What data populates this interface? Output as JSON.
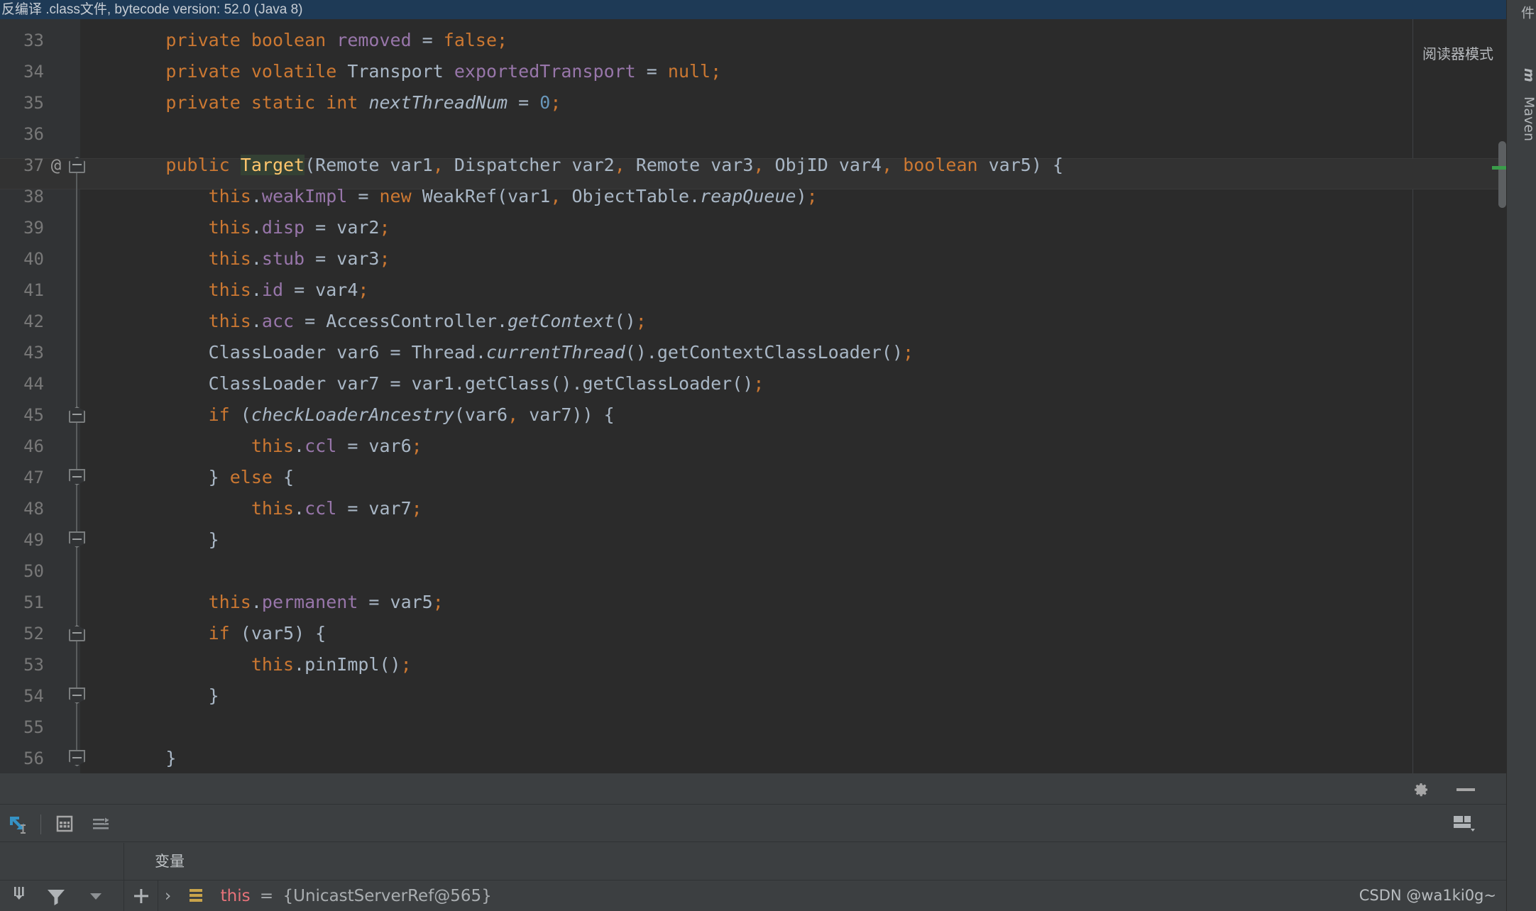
{
  "banner": {
    "text": "反编译 .class文件, bytecode version: 52.0 (Java 8)",
    "background": "#1e3a56"
  },
  "editor": {
    "reader_mode_label": "阅读器模式",
    "caret_line": 37,
    "highlighted_token": "Target",
    "colors": {
      "background": "#2b2b2b",
      "gutter": "#313335",
      "keyword": "#cc7832",
      "field": "#9876aa",
      "identifier": "#a9b7c6",
      "number": "#6897bb",
      "caret_row": "#323232",
      "token_highlight": "#344134",
      "token_highlight_text": "#ffc66d",
      "line_number": "#787878"
    },
    "lines": [
      {
        "num": "33",
        "annotation": "",
        "text": "        private boolean removed = false;"
      },
      {
        "num": "34",
        "annotation": "",
        "text": "        private volatile Transport exportedTransport = null;"
      },
      {
        "num": "35",
        "annotation": "",
        "text": "        private static int nextThreadNum = 0;"
      },
      {
        "num": "36",
        "annotation": "",
        "text": ""
      },
      {
        "num": "37",
        "annotation": "@",
        "text": "        public Target(Remote var1, Dispatcher var2, Remote var3, ObjID var4, boolean var5) {"
      },
      {
        "num": "38",
        "annotation": "",
        "text": "            this.weakImpl = new WeakRef(var1, ObjectTable.reapQueue);"
      },
      {
        "num": "39",
        "annotation": "",
        "text": "            this.disp = var2;"
      },
      {
        "num": "40",
        "annotation": "",
        "text": "            this.stub = var3;"
      },
      {
        "num": "41",
        "annotation": "",
        "text": "            this.id = var4;"
      },
      {
        "num": "42",
        "annotation": "",
        "text": "            this.acc = AccessController.getContext();"
      },
      {
        "num": "43",
        "annotation": "",
        "text": "            ClassLoader var6 = Thread.currentThread().getContextClassLoader();"
      },
      {
        "num": "44",
        "annotation": "",
        "text": "            ClassLoader var7 = var1.getClass().getClassLoader();"
      },
      {
        "num": "45",
        "annotation": "",
        "text": "            if (checkLoaderAncestry(var6, var7)) {"
      },
      {
        "num": "46",
        "annotation": "",
        "text": "                this.ccl = var6;"
      },
      {
        "num": "47",
        "annotation": "",
        "text": "            } else {"
      },
      {
        "num": "48",
        "annotation": "",
        "text": "                this.ccl = var7;"
      },
      {
        "num": "49",
        "annotation": "",
        "text": "            }"
      },
      {
        "num": "50",
        "annotation": "",
        "text": ""
      },
      {
        "num": "51",
        "annotation": "",
        "text": "            this.permanent = var5;"
      },
      {
        "num": "52",
        "annotation": "",
        "text": "            if (var5) {"
      },
      {
        "num": "53",
        "annotation": "",
        "text": "                this.pinImpl();"
      },
      {
        "num": "54",
        "annotation": "",
        "text": "            }"
      },
      {
        "num": "55",
        "annotation": "",
        "text": ""
      },
      {
        "num": "56",
        "annotation": "",
        "text": "        }"
      }
    ]
  },
  "right_sidebar": {
    "tabs": [
      "件",
      "m",
      "Maven"
    ]
  },
  "bottom_panel": {
    "gear_tooltip": "settings-gear",
    "minimize_tooltip": "minimize",
    "layout_tooltip": "layout-settings",
    "toolbar_icons": [
      "evaluate-expression",
      "view-as-table",
      "sort-values"
    ],
    "left_icons": [
      "step-out",
      "filter",
      "more-options"
    ],
    "add_button": "+",
    "variables_tab": "变量",
    "variables": [
      {
        "expander": "›",
        "icon": "stack-frame-icon",
        "name": "this",
        "equals": "=",
        "value": "{UnicastServerRef@565}"
      }
    ]
  },
  "watermark": {
    "text": "CSDN @wa1ki0g~"
  }
}
